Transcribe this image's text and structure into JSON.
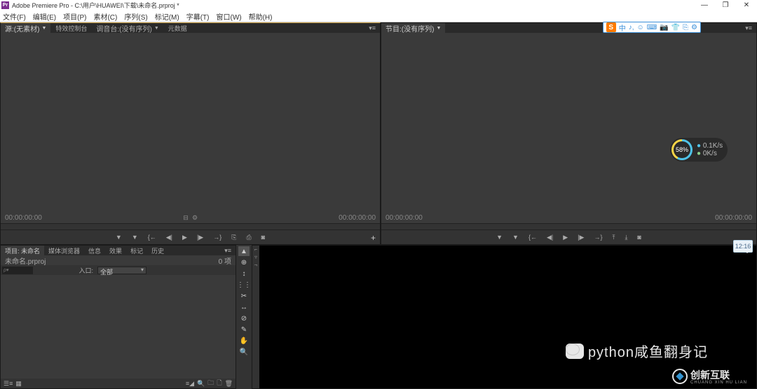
{
  "titlebar": {
    "app_icon": "Pr",
    "title": "Adobe Premiere Pro - C:\\用户\\HUAWEI\\下载\\未命名.prproj *"
  },
  "menubar": [
    "文件(F)",
    "编辑(E)",
    "项目(P)",
    "素材(C)",
    "序列(S)",
    "标记(M)",
    "字幕(T)",
    "窗口(W)",
    "帮助(H)"
  ],
  "source_panel": {
    "tabs": [
      {
        "label": "源:(无素材)",
        "drop": true,
        "active": true
      },
      {
        "label": "特效控制台",
        "active": false
      },
      {
        "label": "调音台:(没有序列)",
        "drop": true,
        "active": false
      },
      {
        "label": "元数据",
        "active": false
      }
    ],
    "tc_left": "00:00:00:00",
    "tc_right": "00:00:00:00"
  },
  "program_panel": {
    "tabs": [
      {
        "label": "节目:(没有序列)",
        "drop": true,
        "active": true
      }
    ],
    "tc_left": "00:00:00:00",
    "tc_right": "00:00:00:00"
  },
  "project_panel": {
    "tabs": [
      "项目: 未命名",
      "媒体浏览器",
      "信息",
      "效果",
      "标记",
      "历史"
    ],
    "active_tab": 0,
    "filename": "未命名.prproj",
    "item_count": "0 项",
    "search_placeholder": "ρ▾",
    "entry_label": "入口:",
    "entry_value": "全部"
  },
  "tools": [
    "▲",
    "⊕",
    "↕",
    "⋮⋮",
    "✂",
    "↔",
    "⊘",
    "✎",
    "✋",
    "🔍"
  ],
  "ime": {
    "s": "S",
    "items": [
      "中",
      "♪,",
      "☺",
      "⌨",
      "📷",
      "👕",
      "⎘",
      "⚙"
    ]
  },
  "perf": {
    "percent": "58%",
    "up": "0.1K/s",
    "down": "0K/s"
  },
  "clock": "12:16",
  "watermark": {
    "wechat": "python咸鱼翻身记",
    "logo_text": "创新互联",
    "logo_sub": "CHUANG XIN HU LIAN"
  }
}
